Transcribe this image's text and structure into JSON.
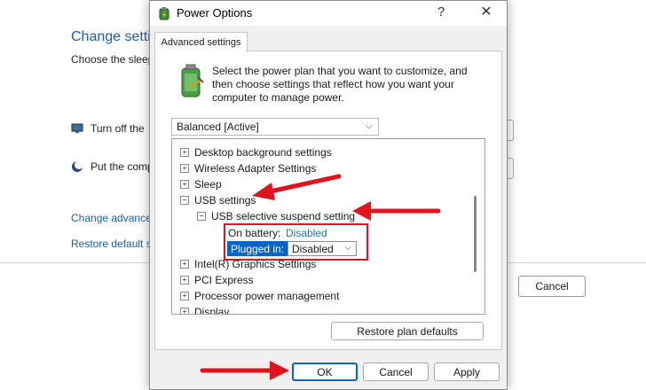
{
  "background": {
    "title": "Change settin",
    "subtitle": "Choose the sleep",
    "rows": [
      {
        "label": "Turn off the",
        "icon": "display-icon"
      },
      {
        "label": "Put the comp",
        "icon": "moon-icon"
      }
    ],
    "links": [
      "Change advance",
      "Restore default s"
    ],
    "cancel_label": "Cancel"
  },
  "dialog": {
    "title": "Power Options",
    "help_label": "?",
    "close_label": "✕",
    "tab_label": "Advanced settings",
    "intro_text": "Select the power plan that you want to customize, and then choose settings that reflect how you want your computer to manage power.",
    "plan_select": {
      "value": "Balanced [Active]"
    },
    "tree": {
      "items": [
        {
          "label": "Desktop background settings",
          "expander": "+"
        },
        {
          "label": "Wireless Adapter Settings",
          "expander": "+"
        },
        {
          "label": "Sleep",
          "expander": "+"
        },
        {
          "label": "USB settings",
          "expander": "−"
        },
        {
          "label": "USB selective suspend setting",
          "expander": "−"
        },
        {
          "label": "Intel(R) Graphics Settings",
          "expander": "+"
        },
        {
          "label": "PCI Express",
          "expander": "+"
        },
        {
          "label": "Processor power management",
          "expander": "+"
        },
        {
          "label": "Display",
          "expander": "+"
        }
      ],
      "on_battery_label": "On battery:",
      "on_battery_value": "Disabled",
      "plugged_in_label": "Plugged in:",
      "plugged_in_value": "Disabled"
    },
    "restore_label": "Restore plan defaults",
    "ok_label": "OK",
    "cancel_label": "Cancel",
    "apply_label": "Apply"
  },
  "colors": {
    "annotation": "#e0141e",
    "selection": "#0a64c8",
    "link": "#1a73c8"
  }
}
